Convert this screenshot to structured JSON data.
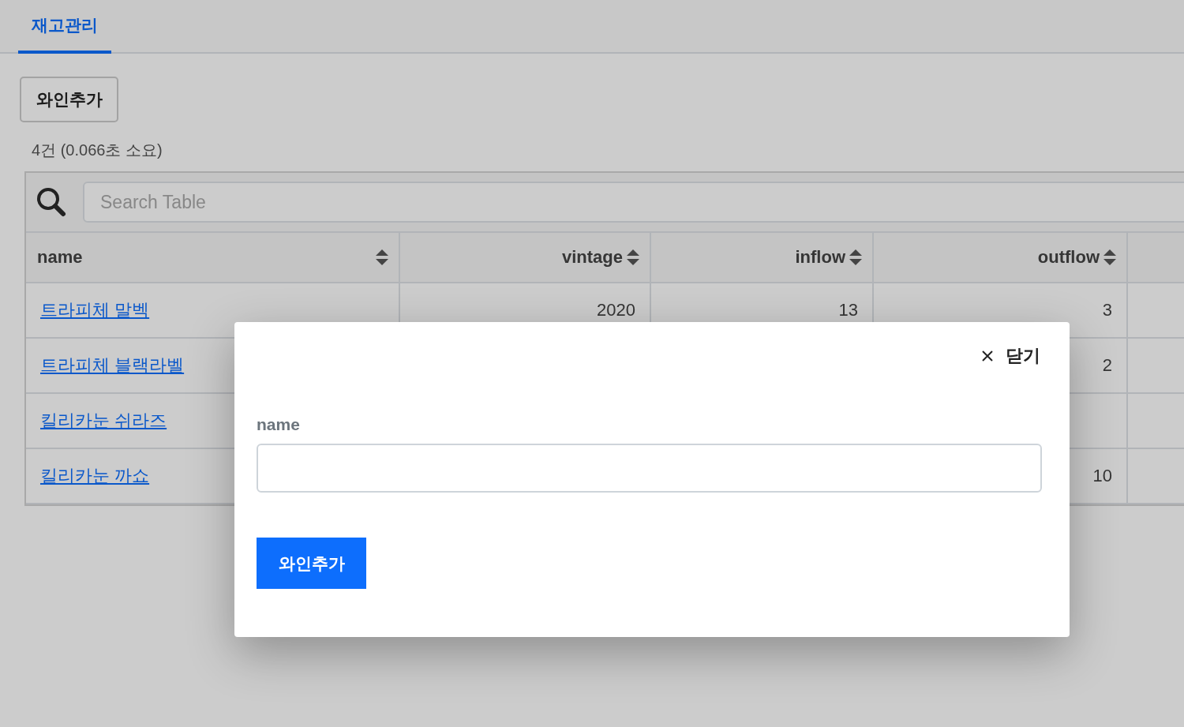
{
  "tabs": [
    {
      "label": "재고관리",
      "selected": true
    }
  ],
  "add_button": "와인추가",
  "result_summary": "4건 (0.066초 소요)",
  "search": {
    "placeholder": "Search Table"
  },
  "table": {
    "columns": [
      {
        "label": "name"
      },
      {
        "label": "vintage"
      },
      {
        "label": "inflow"
      },
      {
        "label": "outflow"
      }
    ],
    "rows": [
      {
        "cells": [
          "트라피체 말벡",
          "2020",
          "13",
          "3"
        ]
      },
      {
        "cells": [
          "트라피체 블랙라벨",
          null,
          null,
          "2"
        ]
      },
      {
        "cells": [
          "킬리카눈 쉬라즈",
          null,
          null,
          null
        ]
      },
      {
        "cells": [
          "킬리카눈 까쇼",
          null,
          null,
          "10"
        ]
      }
    ]
  },
  "modal": {
    "close_label": "닫기",
    "fields": [
      {
        "label": "name"
      }
    ],
    "submit": "와인추가"
  }
}
